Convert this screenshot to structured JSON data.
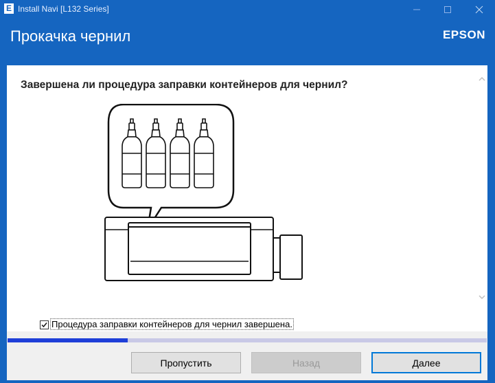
{
  "window": {
    "app_icon_letter": "E",
    "title": "Install Navi [L132 Series]",
    "buttons": [
      "minimize",
      "maximize",
      "close"
    ]
  },
  "header": {
    "title": "Прокачка чернил",
    "brand": "EPSON"
  },
  "main": {
    "question": "Завершена ли процедура заправки контейнеров для чернил?",
    "illustration": {
      "icons": [
        "printer-icon",
        "ink-tank-icon",
        "speech-bubble-icon",
        "ink-bottle-icon"
      ],
      "bottle_count": 4
    },
    "checkbox": {
      "label": "Процедура заправки контейнеров для чернил завершена.",
      "checked": true
    },
    "progress": {
      "value_fraction": 0.25
    }
  },
  "footer": {
    "skip_label": "Пропустить",
    "back_label": "Назад",
    "next_label": "Далее",
    "back_enabled": false
  },
  "colors": {
    "titlebar": "#1565c0",
    "progress_fill": "#1e3fd8",
    "progress_track": "#c9c9e6"
  }
}
